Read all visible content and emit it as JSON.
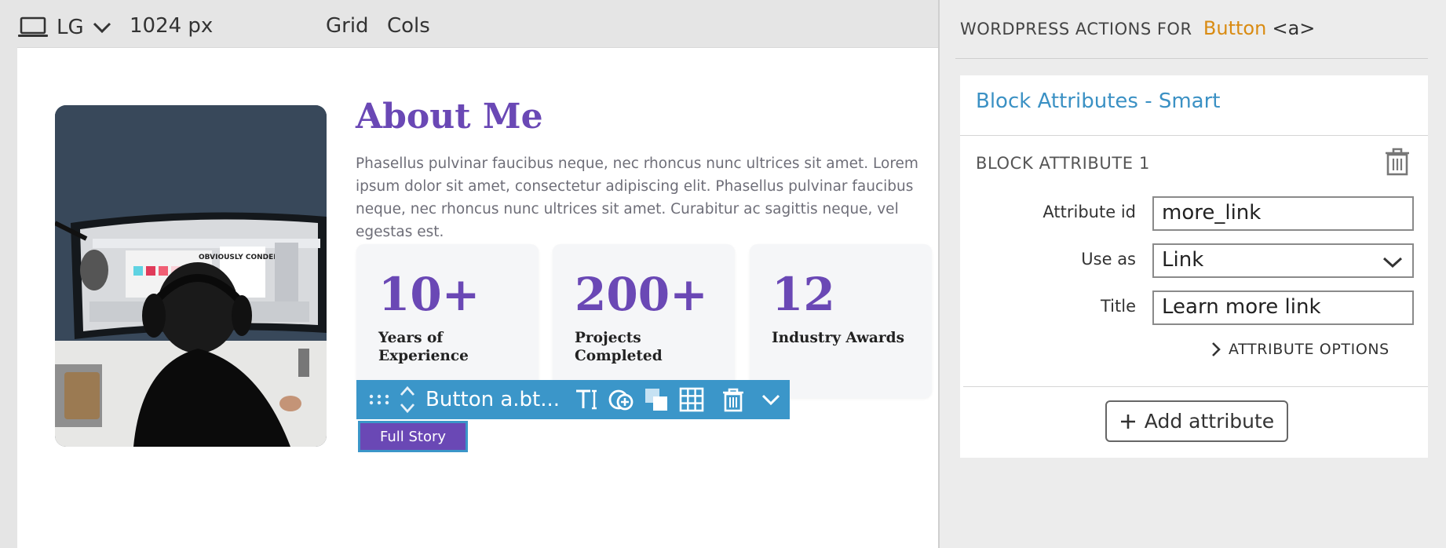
{
  "topbar": {
    "device_icon": "laptop-icon",
    "breakpoint": "LG",
    "width": "1024 px",
    "grid": "Grid",
    "cols": "Cols"
  },
  "about": {
    "title": "About Me",
    "text": "Phasellus pulvinar faucibus neque, nec rhoncus nunc ultrices sit amet. Lorem ipsum dolor sit amet, consectetur adipiscing elit. Phasellus pulvinar faucibus neque, nec rhoncus nunc ultrices sit amet. Curabitur ac sagittis neque, vel egestas est.",
    "stats": [
      {
        "number": "10+",
        "label": "Years of Experience"
      },
      {
        "number": "200+",
        "label": "Projects Completed"
      },
      {
        "number": "12",
        "label": "Industry Awards"
      }
    ],
    "photo_screen_text": "OBVIOUSLY CONDENSED",
    "button_label": "Full Story"
  },
  "block_toolbar": {
    "label": "Button a.bt...",
    "icons": [
      "drag-handle-icon",
      "move-up-down-icon",
      "text-format-icon",
      "add-circle-icon",
      "copy-icon",
      "grid-icon",
      "delete-icon",
      "chevron-down-icon"
    ]
  },
  "panel": {
    "header_prefix": "WORDPRESS ACTIONS FOR",
    "selected_block": "Button",
    "selected_tag": "<a>",
    "card_title": "Block Attributes - Smart",
    "attribute_heading": "BLOCK ATTRIBUTE 1",
    "fields": {
      "attribute_id_label": "Attribute id",
      "attribute_id_value": "more_link",
      "use_as_label": "Use as",
      "use_as_value": "Link",
      "title_label": "Title",
      "title_value": "Learn more link"
    },
    "attribute_options": "ATTRIBUTE OPTIONS",
    "add_attribute": "Add attribute"
  },
  "colors": {
    "brand_purple": "#6a48b5",
    "toolbar_blue": "#3b96c9",
    "panel_title_blue": "#3b91c4",
    "selected_orange": "#d98b12"
  }
}
